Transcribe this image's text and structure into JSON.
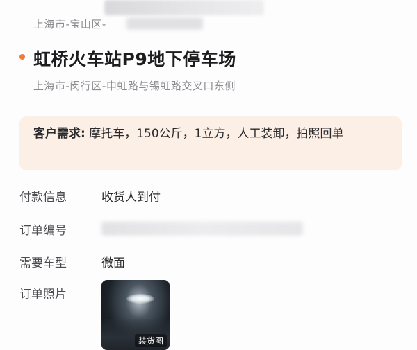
{
  "pickup": {
    "address": "上海市-宝山区-"
  },
  "destination": {
    "title": "虹桥火车站P9地下停车场",
    "address": "上海市-闵行区-申虹路与锡虹路交叉口东侧"
  },
  "demand": {
    "label": "客户需求:",
    "text": " 摩托车，150公斤，1立方，人工装卸，拍照回单"
  },
  "info": {
    "payment_label": "付款信息",
    "payment_value": "收货人到付",
    "order_no_label": "订单编号",
    "vehicle_label": "需要车型",
    "vehicle_value": "微面",
    "photo_label": "订单照片",
    "photo_tag": "装货图"
  },
  "colors": {
    "accent": "#f07a3a",
    "demand_bg": "#fcefe6"
  }
}
